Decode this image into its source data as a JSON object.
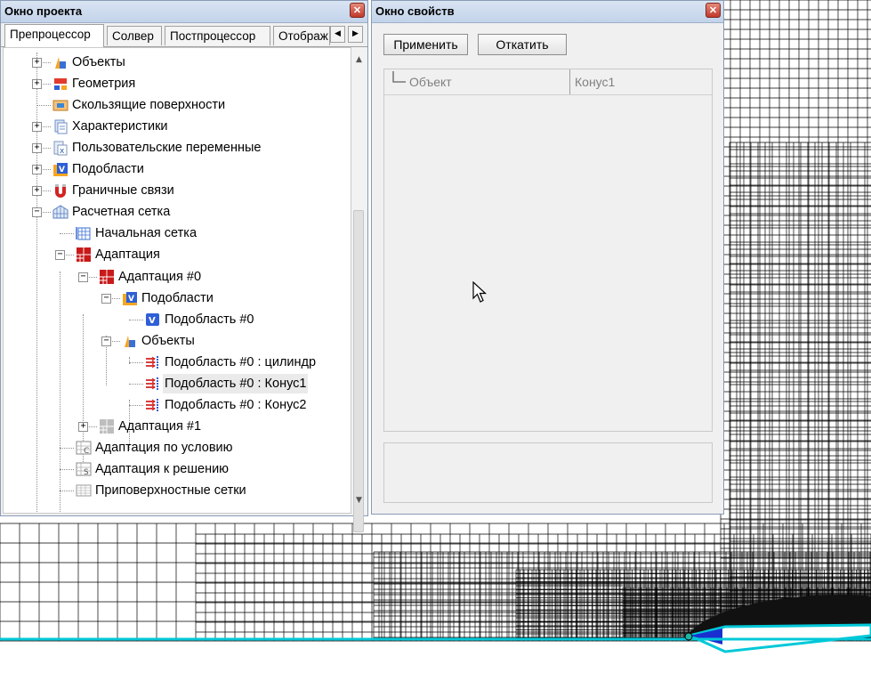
{
  "project_window": {
    "title": "Окно проекта",
    "close_label": "✕",
    "tabs": [
      {
        "label": "Препроцессор",
        "active": true
      },
      {
        "label": "Солвер",
        "active": false
      },
      {
        "label": "Постпроцессор",
        "active": false
      },
      {
        "label": "Отображ",
        "active": false
      }
    ],
    "tree": [
      {
        "label": "Объекты",
        "level": 0,
        "expander": "+",
        "icon": "objects-icon"
      },
      {
        "label": "Геометрия",
        "level": 0,
        "expander": "+",
        "icon": "geometry-icon"
      },
      {
        "label": "Скользящие поверхности",
        "level": 0,
        "expander": "",
        "icon": "sliding-surfaces-icon"
      },
      {
        "label": "Характеристики",
        "level": 0,
        "expander": "+",
        "icon": "characteristics-icon"
      },
      {
        "label": "Пользовательские переменные",
        "level": 0,
        "expander": "+",
        "icon": "user-variables-icon"
      },
      {
        "label": "Подобласти",
        "level": 0,
        "expander": "+",
        "icon": "subdomains-icon"
      },
      {
        "label": "Граничные связи",
        "level": 0,
        "expander": "+",
        "icon": "boundary-links-icon"
      },
      {
        "label": "Расчетная сетка",
        "level": 0,
        "expander": "−",
        "icon": "computational-grid-icon"
      },
      {
        "label": "Начальная сетка",
        "level": 1,
        "expander": "",
        "icon": "initial-grid-icon"
      },
      {
        "label": "Адаптация",
        "level": 1,
        "expander": "−",
        "icon": "adaptation-icon"
      },
      {
        "label": "Адаптация #0",
        "level": 2,
        "expander": "−",
        "icon": "adaptation-icon"
      },
      {
        "label": "Подобласти",
        "level": 3,
        "expander": "−",
        "icon": "subdomains-icon"
      },
      {
        "label": "Подобласть #0",
        "level": 4,
        "expander": "",
        "icon": "subdomain-icon"
      },
      {
        "label": "Объекты",
        "level": 3,
        "expander": "−",
        "icon": "objects-icon"
      },
      {
        "label": "Подобласть #0 : цилиндр",
        "level": 4,
        "expander": "",
        "icon": "object-link-icon"
      },
      {
        "label": "Подобласть #0 : Конус1",
        "level": 4,
        "expander": "",
        "icon": "object-link-icon",
        "selected": true
      },
      {
        "label": "Подобласть #0 : Конус2",
        "level": 4,
        "expander": "",
        "icon": "object-link-icon"
      },
      {
        "label": "Адаптация #1",
        "level": 2,
        "expander": "+",
        "icon": "adaptation-disabled-icon"
      },
      {
        "label": "Адаптация по условию",
        "level": 1,
        "expander": "",
        "icon": "conditional-adaptation-icon"
      },
      {
        "label": "Адаптация к решению",
        "level": 1,
        "expander": "",
        "icon": "solution-adaptation-icon"
      },
      {
        "label": "Приповерхностные сетки",
        "level": 1,
        "expander": "",
        "icon": "near-surface-grid-icon"
      }
    ]
  },
  "properties_window": {
    "title": "Окно свойств",
    "close_label": "✕",
    "apply_label": "Применить",
    "revert_label": "Откатить",
    "rows": [
      {
        "name": "Объект",
        "value": "Конус1"
      }
    ]
  },
  "colors": {
    "title_bar": "#c9d8ee",
    "close_button": "#c0392b",
    "axis_line": "#00c8d8",
    "grid_line": "#000000"
  }
}
